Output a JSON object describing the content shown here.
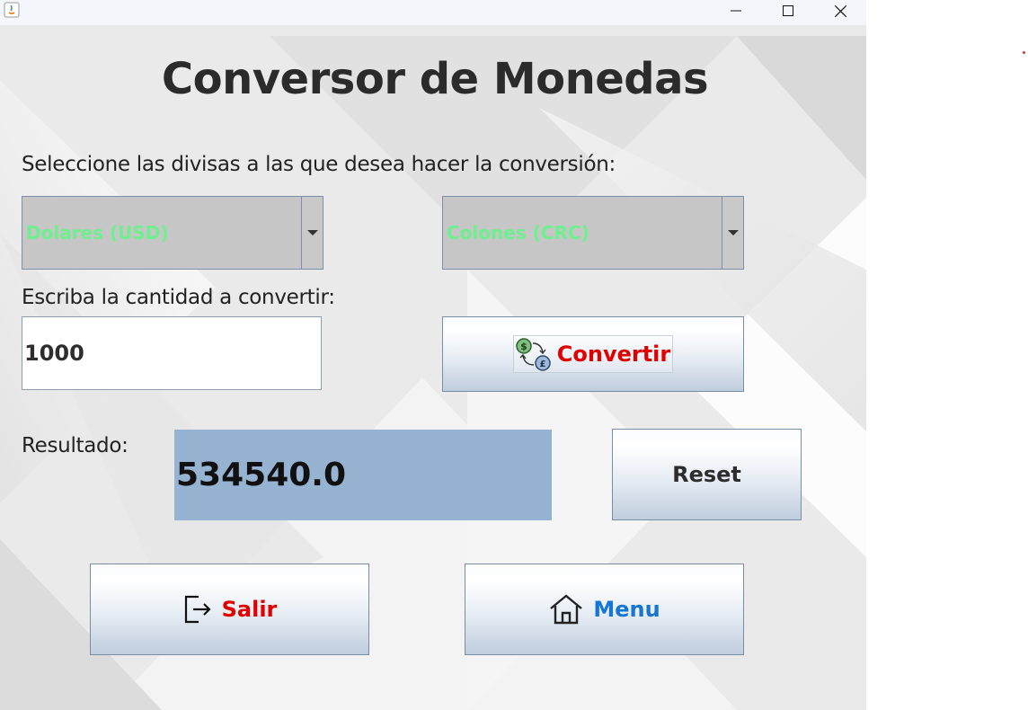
{
  "window": {
    "app_icon": "java-icon",
    "controls": {
      "minimize": "minimize-icon",
      "maximize": "maximize-icon",
      "close": "close-icon"
    }
  },
  "header": {
    "title": "Conversor de Monedas"
  },
  "form": {
    "select_prompt": "Seleccione las divisas a las  que desea hacer la conversión:",
    "from_currency": "Dolares (USD)",
    "to_currency": "Colones (CRC)",
    "amount_prompt": "Escriba la cantidad a convertir:",
    "amount_value": "1000",
    "convert_label": "Convertir",
    "convert_icon": "currency-exchange-icon",
    "result_label": "Resultado:",
    "result_value": "534540.0",
    "reset_label": "Reset"
  },
  "footer": {
    "exit_label": "Salir",
    "exit_icon": "exit-icon",
    "menu_label": "Menu",
    "menu_icon": "home-icon"
  },
  "colors": {
    "combo_text": "#6ef08e",
    "convert_text": "#e00000",
    "exit_text": "#e00000",
    "menu_text": "#1576d4",
    "result_bg": "#97b3d2"
  }
}
